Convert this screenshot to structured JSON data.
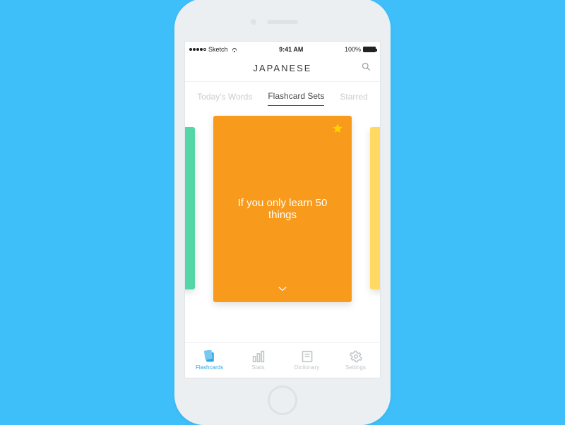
{
  "status": {
    "carrier": "Sketch",
    "time": "9:41 AM",
    "battery": "100%"
  },
  "header": {
    "title": "JAPANESE"
  },
  "tabs": [
    {
      "label": "Today's Words",
      "active": false
    },
    {
      "label": "Flashcard Sets",
      "active": true
    },
    {
      "label": "Starred",
      "active": false
    }
  ],
  "card": {
    "title": "If you only learn 50 things",
    "starred": true,
    "colors": {
      "center": "#f89a1c",
      "left": "#54d6a6",
      "right": "#ffd961"
    }
  },
  "tabbar": [
    {
      "label": "Flashcards",
      "active": true
    },
    {
      "label": "Stats",
      "active": false
    },
    {
      "label": "Dictionary",
      "active": false
    },
    {
      "label": "Settings",
      "active": false
    }
  ]
}
